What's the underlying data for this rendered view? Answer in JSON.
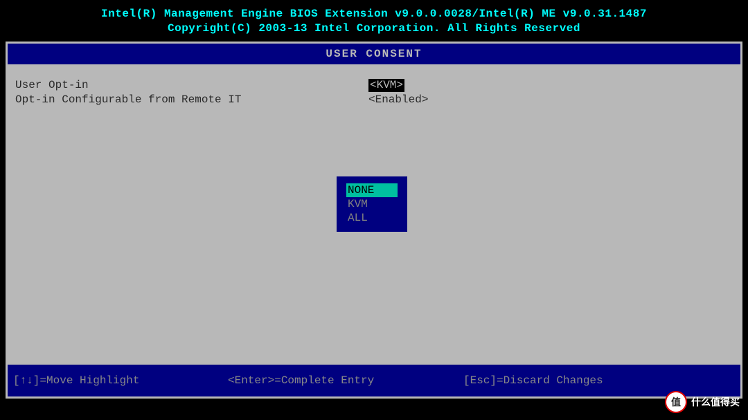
{
  "header": {
    "line1": "Intel(R) Management Engine BIOS Extension v9.0.0.0028/Intel(R) ME v9.0.31.1487",
    "line2": "Copyright(C) 2003-13 Intel Corporation. All Rights Reserved"
  },
  "title": "USER CONSENT",
  "settings": [
    {
      "label": "User Opt-in",
      "value": "<KVM>",
      "selected": true
    },
    {
      "label": "Opt-in Configurable from Remote IT",
      "value": "<Enabled>",
      "selected": false
    }
  ],
  "popup": {
    "items": [
      {
        "label": "NONE",
        "highlighted": true
      },
      {
        "label": "KVM",
        "highlighted": false
      },
      {
        "label": "ALL",
        "highlighted": false
      }
    ]
  },
  "footer": {
    "left": "[↑↓]=Move Highlight",
    "center": "<Enter>=Complete Entry",
    "right": "[Esc]=Discard Changes"
  },
  "watermark": {
    "badge": "值",
    "text": "什么值得买"
  }
}
